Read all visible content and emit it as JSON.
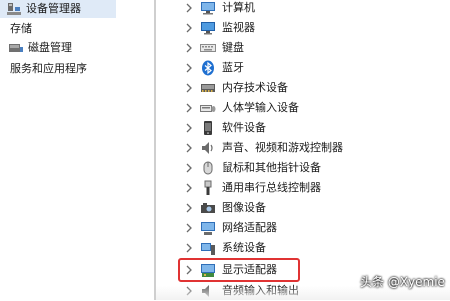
{
  "left_tree": {
    "items": [
      {
        "label": "设备管理器",
        "icon": "device-manager-icon",
        "selected": true
      },
      {
        "label": "存储",
        "icon": "",
        "selected": false
      },
      {
        "label": "磁盘管理",
        "icon": "disk-management-icon",
        "selected": false
      },
      {
        "label": "服务和应用程序",
        "icon": "",
        "selected": false
      }
    ]
  },
  "device_list": {
    "items": [
      {
        "label": "计算机",
        "icon": "computer-icon"
      },
      {
        "label": "监视器",
        "icon": "monitor-icon"
      },
      {
        "label": "键盘",
        "icon": "keyboard-icon"
      },
      {
        "label": "蓝牙",
        "icon": "bluetooth-icon"
      },
      {
        "label": "内存技术设备",
        "icon": "memory-device-icon"
      },
      {
        "label": "人体学输入设备",
        "icon": "hid-icon"
      },
      {
        "label": "软件设备",
        "icon": "software-device-icon"
      },
      {
        "label": "声音、视频和游戏控制器",
        "icon": "speaker-icon"
      },
      {
        "label": "鼠标和其他指针设备",
        "icon": "mouse-icon"
      },
      {
        "label": "通用串行总线控制器",
        "icon": "usb-icon"
      },
      {
        "label": "图像设备",
        "icon": "camera-icon"
      },
      {
        "label": "网络适配器",
        "icon": "network-adapter-icon"
      },
      {
        "label": "系统设备",
        "icon": "system-device-icon"
      },
      {
        "label": "显示适配器",
        "icon": "display-adapter-icon",
        "highlighted": true
      },
      {
        "label": "音频输入和输出",
        "icon": "audio-io-icon"
      }
    ]
  },
  "watermark": "头条 @Xyemie",
  "colors": {
    "highlight_border": "#e03333",
    "selection_bg": "#dfeaf7",
    "bluetooth": "#1e6fd0"
  }
}
